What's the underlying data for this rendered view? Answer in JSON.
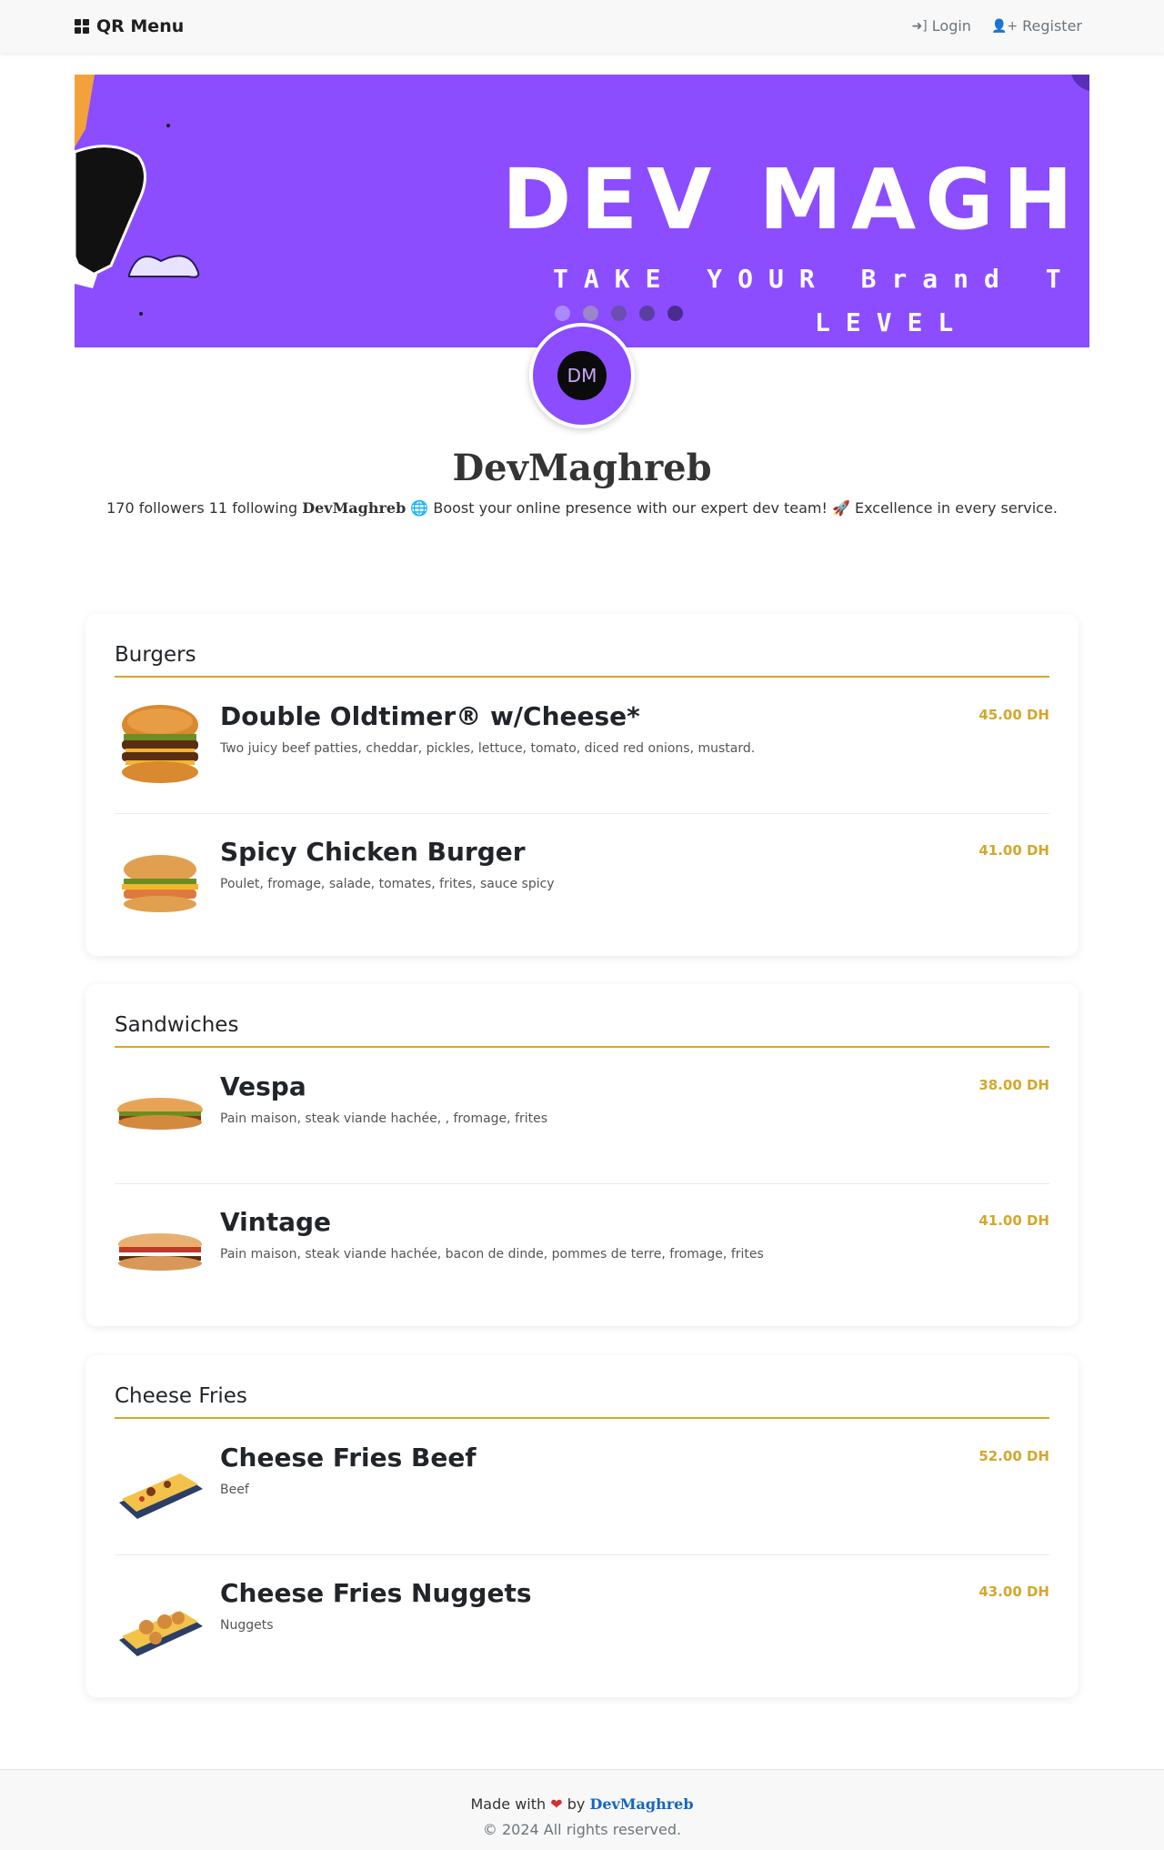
{
  "navbar": {
    "brand": "QR Menu",
    "login": "Login",
    "register": "Register"
  },
  "banner": {
    "title": "DEV MAGHRE",
    "subtitle": "TAKE YOUR Brand T",
    "subtitle2": "LEVEL",
    "dot_colors": [
      "#a98bff",
      "#9a86c8",
      "#6a4fb0",
      "#5a3fa0",
      "#4a2c8f"
    ]
  },
  "avatar": {
    "text": "DM"
  },
  "profile": {
    "name": "DevMaghreb",
    "bio_stats": "170 followers 11 following",
    "bio_name": "DevMaghreb",
    "bio_text": "🌐 Boost your online presence with our expert dev team! 🚀 Excellence in every service."
  },
  "categories": [
    {
      "title": "Burgers",
      "items": [
        {
          "name": "Double Oldtimer® w/Cheese*",
          "desc": "Two juicy beef patties, cheddar, pickles, lettuce, tomato, diced red onions, mustard.",
          "price": "45.00 DH",
          "image": "double-burger"
        },
        {
          "name": "Spicy Chicken Burger",
          "desc": "Poulet, fromage, salade, tomates, frites, sauce spicy",
          "price": "41.00 DH",
          "image": "chicken-burger"
        }
      ]
    },
    {
      "title": "Sandwiches",
      "items": [
        {
          "name": "Vespa",
          "desc": "Pain maison, steak viande hachée, , fromage, frites",
          "price": "38.00 DH",
          "image": "sandwich"
        },
        {
          "name": "Vintage",
          "desc": "Pain maison, steak viande hachée, bacon de dinde, pommes de terre, fromage, frites",
          "price": "41.00 DH",
          "image": "sandwich-2"
        }
      ]
    },
    {
      "title": "Cheese Fries",
      "items": [
        {
          "name": "Cheese Fries Beef",
          "desc": "Beef",
          "price": "52.00 DH",
          "image": "fries-beef"
        },
        {
          "name": "Cheese Fries Nuggets",
          "desc": "Nuggets",
          "price": "43.00 DH",
          "image": "fries-nuggets"
        }
      ]
    }
  ],
  "footer": {
    "made_with": "Made with",
    "by": "by",
    "author": "DevMaghreb",
    "copyright": "© 2024 All rights reserved."
  },
  "colors": {
    "accent": "#d4a72c",
    "banner": "#8b4dff",
    "link": "#1565c0"
  }
}
